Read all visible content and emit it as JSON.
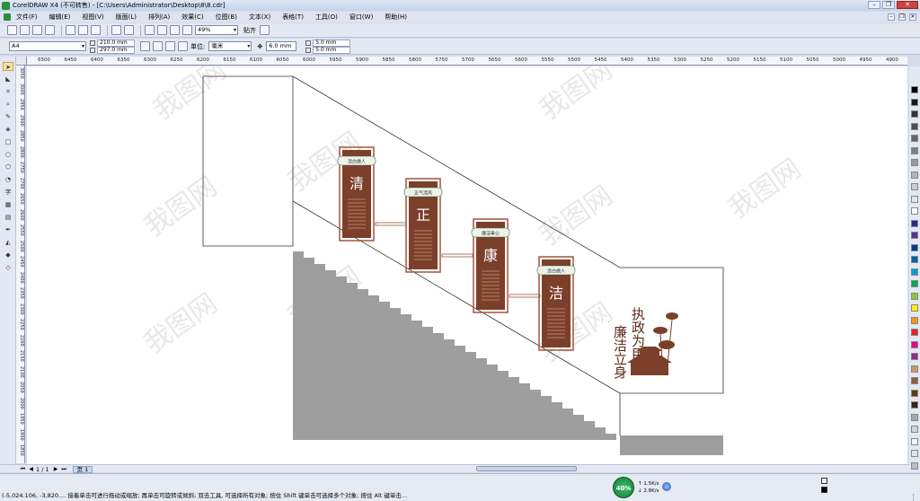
{
  "window": {
    "title": "CorelDRAW X4 (不可转售) - [C:\\Users\\Administrator\\Desktop\\8\\8.cdr]"
  },
  "menu": {
    "items": [
      "文件(F)",
      "编辑(E)",
      "视图(V)",
      "版面(L)",
      "排列(A)",
      "效果(C)",
      "位图(B)",
      "文本(X)",
      "表格(T)",
      "工具(O)",
      "窗口(W)",
      "帮助(H)"
    ]
  },
  "toolbar": {
    "zoom": "49%",
    "snap_label": "贴齐"
  },
  "property_bar": {
    "paper_size": "A4",
    "width": "210.0 mm",
    "height": "297.0 mm",
    "unit_label": "单位:",
    "unit_value": "毫米",
    "nudge": "6.0 mm",
    "dup_x": "5.0 mm",
    "dup_y": "5.0 mm"
  },
  "ruler": {
    "h_labels": [
      "6500",
      "6450",
      "6400",
      "6350",
      "6300",
      "6250",
      "6200",
      "6150",
      "6100",
      "6050",
      "6000",
      "5950",
      "5900",
      "5850",
      "5800",
      "5750",
      "5700",
      "5650",
      "5600",
      "5550",
      "5500",
      "5450",
      "5400",
      "5350",
      "5300",
      "5250",
      "5200",
      "5150",
      "5100",
      "5050",
      "5000",
      "4950",
      "4900"
    ],
    "v_labels": [
      "3050",
      "3000",
      "2950",
      "2900",
      "2850",
      "2800",
      "2750",
      "2700",
      "2650",
      "2600",
      "2550",
      "2500",
      "2450",
      "2400",
      "2350",
      "2300",
      "2250",
      "2200",
      "2150",
      "2100",
      "2050",
      "2000",
      "1950",
      "1900",
      "1850"
    ]
  },
  "canvas": {
    "panels": [
      {
        "char": "清",
        "header": "清白做人"
      },
      {
        "char": "正",
        "header": "正气清风"
      },
      {
        "char": "康",
        "header": "廉洁奉公"
      },
      {
        "char": "洁",
        "header": "清白做人"
      }
    ],
    "slogan_col1": "执政为民",
    "slogan_col2": "廉洁立身",
    "watermark": "我图网"
  },
  "page_nav": {
    "counter": "1 / 1",
    "tab": "页 1"
  },
  "status": {
    "text": "(-5,024.106, -3,820.... 接着单击可进行拖动或缩放; 再单击可旋转或倾斜; 双击工具, 可选择所有对象; 按住 Shift 键单击可选择多个对象; 按住 Alt 键单击...",
    "net_percent": "40%",
    "upload": "1.5K/s",
    "download": "2.8K/s"
  },
  "colors": {
    "panel_brown": "#7b3f2a",
    "panel_frame": "#a0553b",
    "stair_gray": "#9e9e9e",
    "palette": [
      "#000000",
      "#1a1a1a",
      "#333333",
      "#4d4d4d",
      "#666666",
      "#808080",
      "#999999",
      "#b3b3b3",
      "#cccccc",
      "#e6e6e6",
      "#ffffff",
      "#2b2b8c",
      "#5c2d91",
      "#003f87",
      "#0060b0",
      "#00a0e0",
      "#00a651",
      "#8dc63f",
      "#fff200",
      "#f7941d",
      "#ed1c24",
      "#ec008c",
      "#92278f",
      "#c69c6d",
      "#8b5e3c",
      "#603913",
      "#3c2415",
      "#a7a9ac",
      "#d1d3d4",
      "#f1f2f2",
      "#e2e3e4",
      "#bdbec0"
    ]
  }
}
